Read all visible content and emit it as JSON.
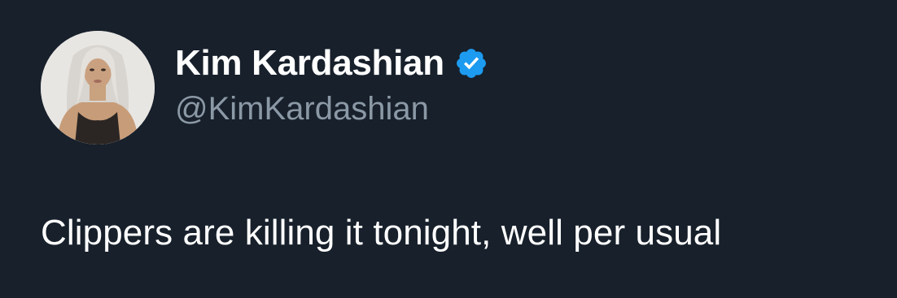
{
  "tweet": {
    "author": {
      "display_name": "Kim Kardashian",
      "handle": "@KimKardashian",
      "verified": true,
      "avatar_icon": "profile-photo",
      "verified_icon": "verified-badge-icon"
    },
    "text": "Clippers are killing it tonight, well per usual"
  },
  "colors": {
    "background": "#17202b",
    "name": "#ffffff",
    "handle": "#8b98a5",
    "verified": "#1d9bf0"
  }
}
